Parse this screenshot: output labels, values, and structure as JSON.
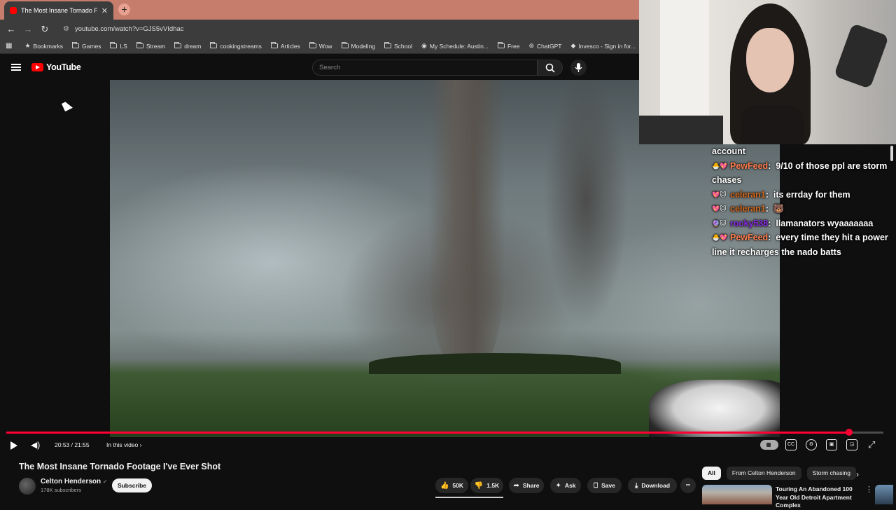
{
  "browser": {
    "tab_title": "The Most Insane Tornado Foota",
    "tab_close": "✕",
    "new_tab": "+",
    "url": "youtube.com/watch?v=GJS5vVIdhac",
    "bookmarks": [
      "Bookmarks",
      "Games",
      "LS",
      "Stream",
      "dream",
      "cookingstreams",
      "Articles",
      "Wow",
      "Modeling",
      "School",
      "My Schedule: Austin...",
      "Free",
      "ChatGPT",
      "Invesco - Sign in for..."
    ]
  },
  "youtube": {
    "logo_text": "YouTube",
    "search_placeholder": "Search"
  },
  "player": {
    "time": "20:53 / 21:55",
    "chapter_label": "In this video ›",
    "progress": 0.961,
    "controls": [
      "autoplay",
      "subtitles",
      "settings",
      "miniplayer",
      "cast",
      "fullscreen"
    ]
  },
  "chat": {
    "messages": [
      {
        "user": "",
        "badges": "",
        "text": "account",
        "color": "#ffffff"
      },
      {
        "user": "PewFeed",
        "badges": "🐣💖",
        "text": "9/10 of those ppl are storm chases",
        "color": "#ff7f50"
      },
      {
        "user": "celeran1",
        "badges": "💖🐱",
        "text": "its errday for them",
        "color": "#d2691e"
      },
      {
        "user": "celeran1",
        "badges": "💖🐱",
        "text": "🐻",
        "color": "#d2691e"
      },
      {
        "user": "rocky538",
        "badges": "🔮🐱",
        "text": "llamanators wyaaaaaaa",
        "color": "#8a2be2"
      },
      {
        "user": "PewFeed",
        "badges": "🐣💖",
        "text": "every time they hit a power line it recharges the nado batts",
        "color": "#ff7f50"
      }
    ]
  },
  "video": {
    "title": "The Most Insane Tornado Footage I've Ever Shot",
    "channel": "Celton Henderson",
    "verified": "✓",
    "subscribers": "178K subscribers",
    "subscribe_label": "Subscribe",
    "likes": "50K",
    "dislikes": "1.5K",
    "share": "Share",
    "ask": "Ask",
    "save": "Save",
    "download": "Download",
    "more": "•••"
  },
  "recommendations": {
    "chips": [
      "All",
      "From Celton Henderson",
      "Storm chasing"
    ],
    "first_title": "Touring An Abandoned 100 Year Old Detroit Apartment Complex"
  }
}
